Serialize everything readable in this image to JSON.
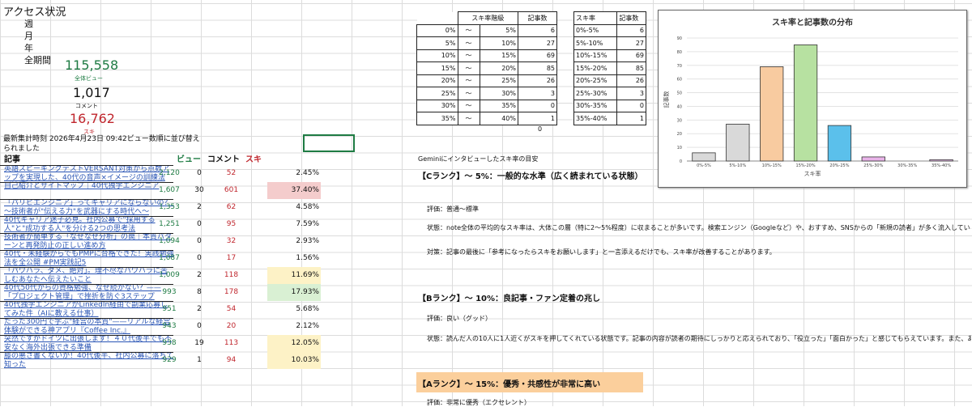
{
  "access": {
    "title": "アクセス状況",
    "periods": [
      "週",
      "月",
      "年",
      "全期間"
    ],
    "total_views": "115,558",
    "total_views_label": "全体ビュー",
    "comments": "1,017",
    "comments_label": "コメント",
    "suki": "16,762",
    "suki_label": "スキ",
    "note": "最新集計時刻 2026年4月23日 09:42ビュー数順に並び替えられました"
  },
  "articles": {
    "headers": {
      "title": "記事",
      "view": "ビュー",
      "comment": "コメント",
      "suki": "スキ"
    },
    "rows": [
      {
        "title": "英語スピーキングテストVERSANT対策から点数アップを実現した、40代の音声×イメージの訓練法（持續）",
        "views": "2,120",
        "comments": "0",
        "suki": "52",
        "rate": "2.45%",
        "hl": ""
      },
      {
        "title": "自己紹介とサイトマップ｜40代独学エンジニア",
        "views": "1,607",
        "comments": "30",
        "suki": "601",
        "rate": "37.40%",
        "hl": "#f4cccc"
      },
      {
        "title": "「パリピエンジニア」ってキャリアにならないの？　～技術者が\"伝える力\"を武器にする時代へ～",
        "views": "1,353",
        "comments": "2",
        "suki": "62",
        "rate": "4.58%",
        "hl": ""
      },
      {
        "title": "40代キャリア迷子必見。社内公募で\"採用する人\"と\"成功する人\"を分ける2つの思考法",
        "views": "1,251",
        "comments": "0",
        "suki": "95",
        "rate": "7.59%",
        "hl": ""
      },
      {
        "title": "技術者が簡単する「なぜなぜ分析」の罠｜本質パターンと再発防止の正しい進め方",
        "views": "1,094",
        "comments": "0",
        "suki": "32",
        "rate": "2.93%",
        "hl": ""
      },
      {
        "title": "40代・未経験からでもPMPに合格できた！実践勉強法を全公開 #PM実践記5",
        "views": "1,087",
        "comments": "0",
        "suki": "17",
        "rate": "1.56%",
        "hl": ""
      },
      {
        "title": "「パワハラ、ダメ、絶対」。理不尽なパワハラに苦しむあなたへ伝えたいこと",
        "views": "1,009",
        "comments": "2",
        "suki": "118",
        "rate": "11.69%",
        "hl": "#fdf2c6"
      },
      {
        "title": "40代50代からの資格勉強、なぜ続かない？——「プロジェクト管理」で挫折を防ぐ3ステップ",
        "views": "993",
        "comments": "8",
        "suki": "178",
        "rate": "17.93%",
        "hl": "#d9f0d3"
      },
      {
        "title": "40代独学エンジニアがLinkedIn経由で副業応募してみた件（AIに教える仕事）",
        "views": "951",
        "comments": "2",
        "suki": "54",
        "rate": "5.68%",
        "hl": ""
      },
      {
        "title": "たった300円で学ぶ\"経営の本質\"——リアルな経営体験ができる神アプリ『Coffee Inc.』",
        "views": "943",
        "comments": "0",
        "suki": "20",
        "rate": "2.12%",
        "hl": ""
      },
      {
        "title": "突然ですがドイツに出張します！４０代後半でも不安なく海外出張できる準備",
        "views": "938",
        "comments": "19",
        "suki": "113",
        "rate": "12.05%",
        "hl": "#fdf2c6"
      },
      {
        "title": "膝の悪さ書くないか！40代後半、社内公募に落ちて知った",
        "views": "929",
        "comments": "1",
        "suki": "94",
        "rate": "10.03%",
        "hl": "#fdf2c6"
      }
    ]
  },
  "dist_table": {
    "headers": [
      "スキ率階級",
      "記事数"
    ],
    "tilde": "～",
    "rows": [
      {
        "from": "0%",
        "to": "5%",
        "count": "6"
      },
      {
        "from": "5%",
        "to": "10%",
        "count": "27"
      },
      {
        "from": "10%",
        "to": "15%",
        "count": "69"
      },
      {
        "from": "15%",
        "to": "20%",
        "count": "85"
      },
      {
        "from": "20%",
        "to": "25%",
        "count": "26"
      },
      {
        "from": "25%",
        "to": "30%",
        "count": "3"
      },
      {
        "from": "30%",
        "to": "35%",
        "count": "0"
      },
      {
        "from": "35%",
        "to": "40%",
        "count": "1"
      }
    ],
    "extra": "0"
  },
  "rate_table": {
    "headers": [
      "スキ率",
      "記事数"
    ],
    "rows": [
      {
        "label": "0%-5%",
        "count": "6"
      },
      {
        "label": "5%-10%",
        "count": "27"
      },
      {
        "label": "10%-15%",
        "count": "69"
      },
      {
        "label": "15%-20%",
        "count": "85"
      },
      {
        "label": "20%-25%",
        "count": "26"
      },
      {
        "label": "25%-30%",
        "count": "3"
      },
      {
        "label": "30%-35%",
        "count": "0"
      },
      {
        "label": "35%-40%",
        "count": "1"
      }
    ]
  },
  "guide": {
    "intro": "Geminiにインタビューしたスキ率の目安",
    "c_rank": "【Cランク】～ 5%：一般的な水準（広く読まれている状態）",
    "c_eval": "評価：普通～標準",
    "c_state": "状態：note全体の平均的なスキ率は、大体この層（特に2～5%程度）に収まることが多いです。検索エンジン（Googleなど）や、おすすめ、SNSからの「新規の読者」が多く流入している場合、PVは伸びますがスキを押さずに",
    "c_action": "対策：記事の最後に「参考になったらスキをお願いします」と一言添えるだけでも、スキ率が改善することがあります。",
    "b_rank": "【Bランク】～ 10%：良記事・ファン定着の兆し",
    "b_eval": "評価：良い（グッド）",
    "b_state": "状態：読んだ人の10人に1人近くがスキを押してくれている状態です。記事の内容が読者の期待にしっかりと応えられており、「役立った」「面白かった」と感じてもらえています。また、あなたの固定ファン（フォロワー）がコンスタントに",
    "a_rank": "【Aランク】～ 15%：優秀・共感性が非常に高い",
    "a_eval": "評価：非常に優秀（エクセレント）"
  },
  "chart_data": {
    "type": "bar",
    "title": "スキ率と記事数の分布",
    "xlabel": "スキ率",
    "ylabel": "記事数",
    "categories": [
      "0%-5%",
      "5%-10%",
      "10%-15%",
      "15%-20%",
      "20%-25%",
      "25%-30%",
      "30%-35%",
      "35%-40%"
    ],
    "values": [
      6,
      27,
      69,
      85,
      26,
      3,
      0,
      1
    ],
    "colors": [
      "#d9d9d9",
      "#d9d9d9",
      "#f8cba0",
      "#b7e1a1",
      "#5bc0eb",
      "#e9b3e9",
      "#f3c6f3",
      "#f3c6f3"
    ],
    "ylim": [
      0,
      90
    ],
    "yticks": [
      0,
      10,
      20,
      30,
      40,
      50,
      60,
      70,
      80,
      90
    ],
    "grid": true,
    "legend": "none"
  }
}
